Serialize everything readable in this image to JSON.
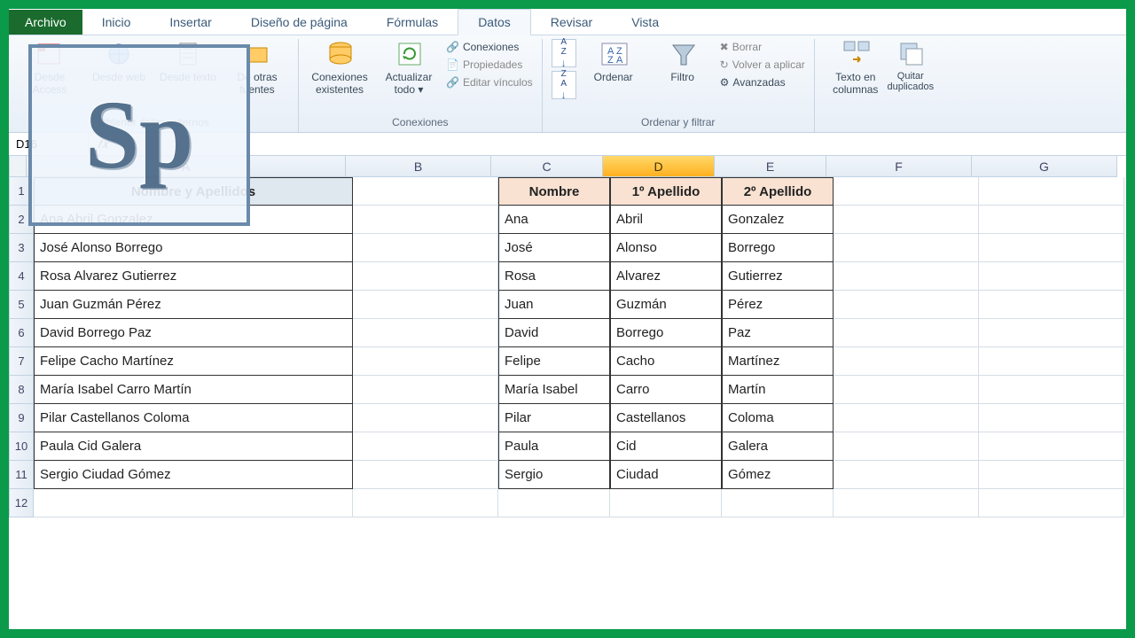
{
  "tabs": {
    "file": "Archivo",
    "items": [
      "Inicio",
      "Insertar",
      "Diseño de página",
      "Fórmulas",
      "Datos",
      "Revisar",
      "Vista"
    ],
    "active": "Datos"
  },
  "ribbon": {
    "group_extern_label": "Obtener datos externos",
    "desde_access": "Desde Access",
    "desde_web": "Desde web",
    "desde_texto": "Desde texto",
    "de_otras": "De otras fuentes",
    "conexiones_existentes": "Conexiones existentes",
    "actualizar_todo": "Actualizar todo ▾",
    "group_conexiones_label": "Conexiones",
    "conexiones": "Conexiones",
    "propiedades": "Propiedades",
    "editar_vinculos": "Editar vínculos",
    "ordenar": "Ordenar",
    "filtro": "Filtro",
    "group_ordenar_label": "Ordenar y filtrar",
    "borrar": "Borrar",
    "volver_aplicar": "Volver a aplicar",
    "avanzadas": "Avanzadas",
    "texto_columnas": "Texto en columnas",
    "quitar_dup": "Quitar duplicados"
  },
  "namebox": "D16",
  "columns": [
    "A",
    "B",
    "C",
    "D",
    "E",
    "F",
    "G"
  ],
  "selected_col": "D",
  "headers": {
    "a": "Nombre y Apellidos",
    "c": "Nombre",
    "d": "1º  Apellido",
    "e": "2º Apellido"
  },
  "rows": [
    {
      "full": "Ana Abril Gonzalez",
      "n": "Ana",
      "a1": "Abril",
      "a2": "Gonzalez"
    },
    {
      "full": "José Alonso Borrego",
      "n": "José",
      "a1": "Alonso",
      "a2": "Borrego"
    },
    {
      "full": "Rosa Alvarez Gutierrez",
      "n": "Rosa",
      "a1": "Alvarez",
      "a2": "Gutierrez"
    },
    {
      "full": "Juan Guzmán Pérez",
      "n": "Juan",
      "a1": "Guzmán",
      "a2": "Pérez"
    },
    {
      "full": "David Borrego  Paz",
      "n": "David",
      "a1": "Borrego",
      "a2": "Paz"
    },
    {
      "full": "Felipe Cacho Martínez",
      "n": "Felipe",
      "a1": "Cacho",
      "a2": "Martínez"
    },
    {
      "full": "María Isabel Carro Martín",
      "n": "María Isabel",
      "a1": "Carro",
      "a2": "Martín"
    },
    {
      "full": "Pilar Castellanos Coloma",
      "n": "Pilar",
      "a1": "Castellanos",
      "a2": "Coloma"
    },
    {
      "full": "Paula Cid Galera",
      "n": "Paula",
      "a1": "Cid",
      "a2": "Galera"
    },
    {
      "full": "Sergio Ciudad Gómez",
      "n": "Sergio",
      "a1": "Ciudad",
      "a2": "Gómez"
    }
  ],
  "watermark": "Sp"
}
